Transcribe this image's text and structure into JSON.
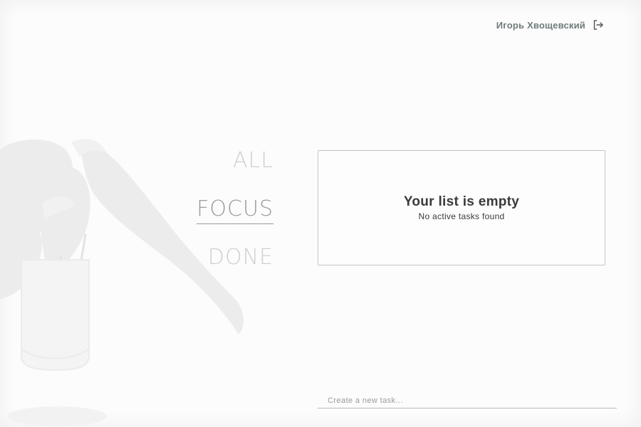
{
  "header": {
    "user_name": "Игорь Хвощевский",
    "logout_icon": "logout-icon"
  },
  "filters": {
    "items": [
      {
        "label": "ALL",
        "active": false
      },
      {
        "label": "FOCUS",
        "active": true
      },
      {
        "label": "DONE",
        "active": false
      }
    ]
  },
  "task_list": {
    "empty_title": "Your list is empty",
    "empty_subtitle": "No active tasks found"
  },
  "new_task": {
    "placeholder": "Create a new task...",
    "value": ""
  },
  "decor": {
    "illustration": "plant-in-vase-icon"
  },
  "colors": {
    "filter_inactive": "#cfcfcf",
    "filter_active": "#9b9b9b",
    "panel_border": "#c4c4c4",
    "user_name": "#6f7a7a"
  }
}
